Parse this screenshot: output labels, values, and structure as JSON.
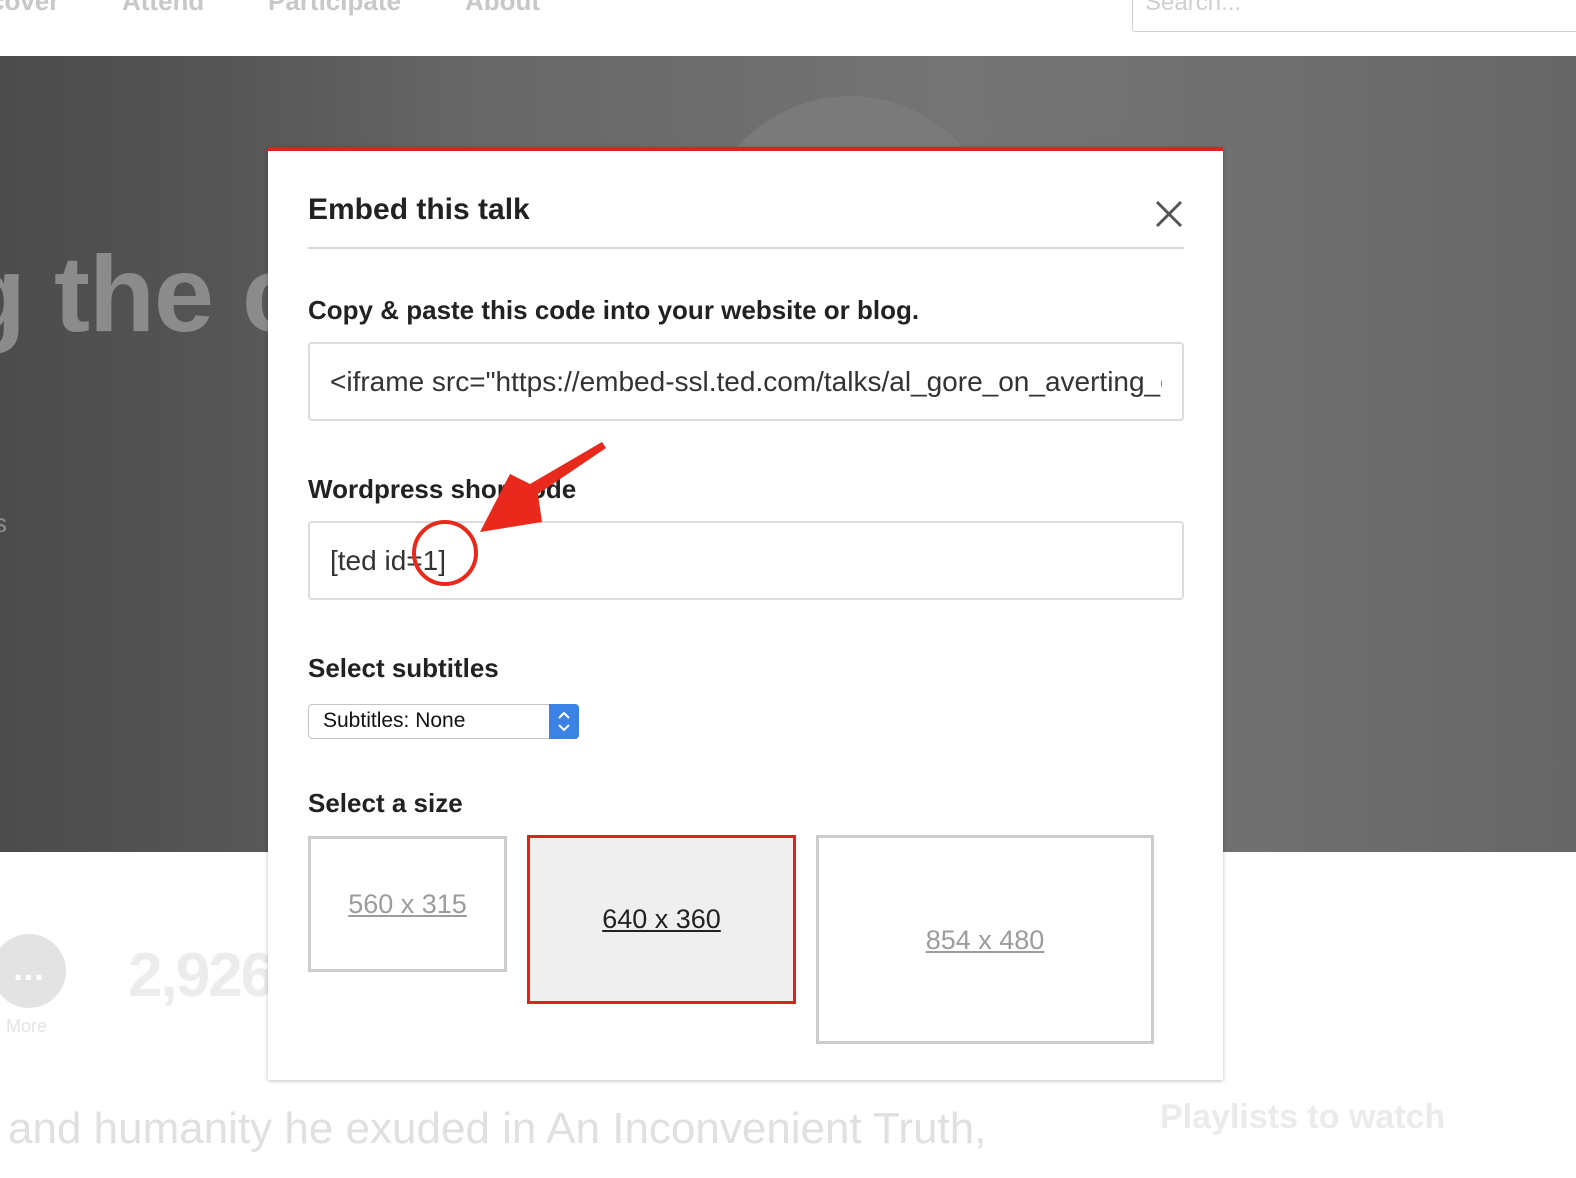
{
  "nav": {
    "items": [
      "cover",
      "Attend",
      "Participate",
      "About"
    ],
    "search_placeholder": "Search..."
  },
  "hero": {
    "title_fragment": "g the c",
    "side_fragment": "s"
  },
  "talk_meta": {
    "more_icon": "...",
    "more_label": "More",
    "views": "2,926",
    "description_fragment": "and humanity he exuded in An Inconvenient Truth,",
    "playlists_heading": "Playlists to watch"
  },
  "modal": {
    "title": "Embed this talk",
    "close_icon": "close-icon",
    "embed_label": "Copy & paste this code into your website or blog.",
    "embed_code": "<iframe src=\"https://embed-ssl.ted.com/talks/al_gore_on_averting_climate_crisis.html\" width=\"640\" height=\"360\" frameborder=\"0\" scrolling=\"no\" allowfullscreen></iframe>",
    "shortcode_label": "Wordpress shortcode",
    "shortcode_value": "[ted id=1]",
    "subtitles_label": "Select subtitles",
    "subtitles_value": "Subtitles: None",
    "size_label": "Select a size",
    "sizes": [
      {
        "label": "560 x 315",
        "selected": false
      },
      {
        "label": "640 x 360",
        "selected": true
      },
      {
        "label": "854 x 480",
        "selected": false
      }
    ],
    "accent_color": "#d7261e",
    "select_accent_color": "#3b82e6"
  },
  "annotation": {
    "color": "#e8291c",
    "shapes": [
      "red-arrow",
      "red-circle"
    ]
  }
}
